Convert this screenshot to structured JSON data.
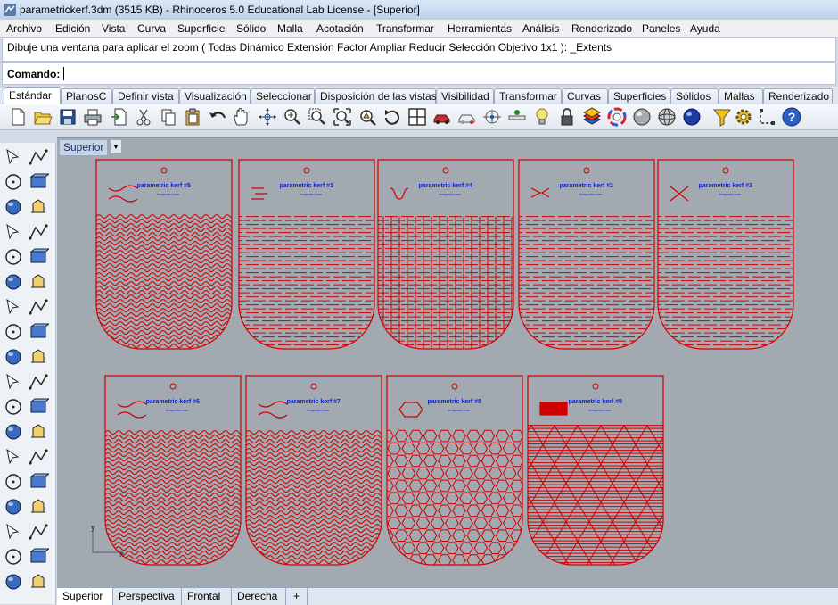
{
  "window": {
    "title": "parametrickerf.3dm (3515 KB) - Rhinoceros 5.0 Educational Lab License - [Superior]"
  },
  "menu": [
    "Archivo",
    "Edición",
    "Vista",
    "Curva",
    "Superficie",
    "Sólido",
    "Malla",
    "Acotación",
    "Transformar",
    "Herramientas",
    "Análisis",
    "Renderizado",
    "Paneles",
    "Ayuda"
  ],
  "command": {
    "history": "Dibuje una ventana para aplicar el zoom ( Todas  Dinámico  Extensión  Factor  Ampliar  Reducir  Selección  Objetivo  1x1 ): _Extents",
    "prompt_label": "Comando:",
    "value": ""
  },
  "toolbar_tabs": [
    "Estándar",
    "PlanosC",
    "Definir vista",
    "Visualización",
    "Seleccionar",
    "Disposición de las vistas",
    "Visibilidad",
    "Transformar",
    "Curvas",
    "Superficies",
    "Sólidos",
    "Mallas",
    "Renderizado"
  ],
  "toolbar_icons": [
    "new-icon",
    "open-icon",
    "save-icon",
    "print-icon",
    "import-icon",
    "cut-icon",
    "copy-icon",
    "paste-icon",
    "undo-icon",
    "pan-icon",
    "rotate-view-icon",
    "zoom-dynamic-icon",
    "zoom-window-icon",
    "zoom-extents-icon",
    "zoom-selected-icon",
    "rotate-icon",
    "four-views-icon",
    "car-icon",
    "car-outline-icon",
    "cplane-icon",
    "point-icon",
    "light-icon",
    "lock-icon",
    "layer-icon",
    "color-wheel-icon",
    "render-sphere-icon",
    "render-wire-sphere-icon",
    "render-blue-sphere-icon",
    "filter-icon",
    "settings-icon",
    "snap-icon",
    "help-icon"
  ],
  "viewport": {
    "title": "Superior",
    "panels": [
      {
        "label": "parametric kerf #5",
        "site": "fenquatcl.com"
      },
      {
        "label": "parametric kerf #1",
        "site": "fenquatcl.com"
      },
      {
        "label": "parametric kerf #4",
        "site": "fenquatcl.com"
      },
      {
        "label": "parametric kerf #2",
        "site": "fenquatcl.com"
      },
      {
        "label": "parametric kerf #3",
        "site": "fenquatcl.com"
      },
      {
        "label": "parametric kerf #6",
        "site": "fenquatcl.com"
      },
      {
        "label": "parametric kerf #7",
        "site": "fenquatcl.com"
      },
      {
        "label": "parametric kerf #8",
        "site": "fenquatcl.com"
      },
      {
        "label": "parametric kerf #9",
        "site": "fenquatcl.com"
      }
    ],
    "axis_x": "x",
    "axis_y": "y",
    "line_color": "#d00000",
    "background": "#a3a9b0"
  },
  "view_tabs": [
    "Superior",
    "Perspectiva",
    "Frontal",
    "Derecha"
  ],
  "view_tab_add": "+"
}
